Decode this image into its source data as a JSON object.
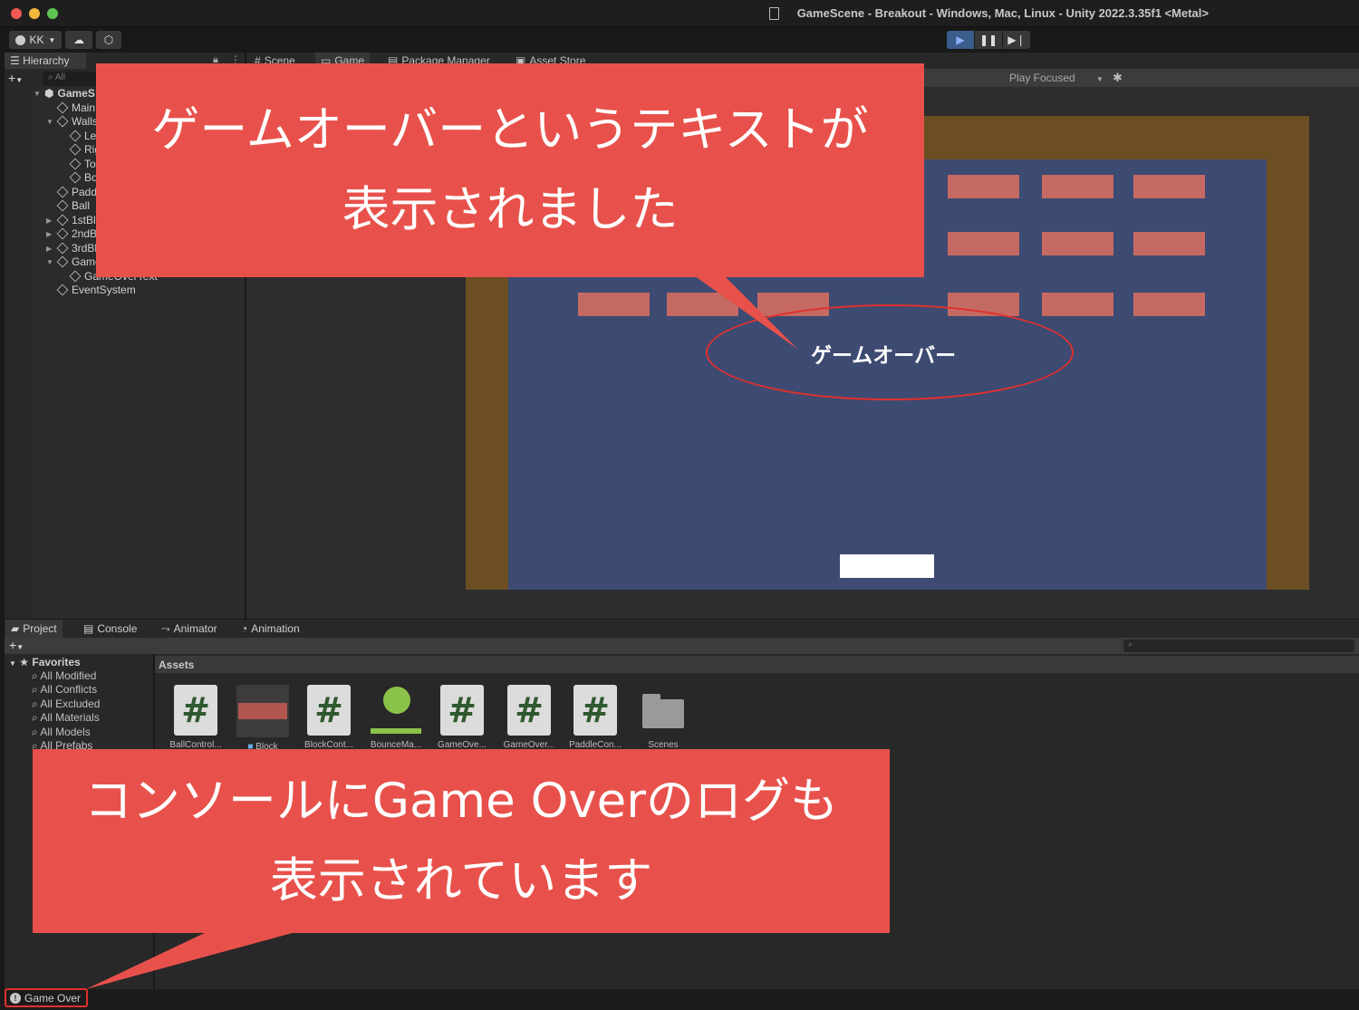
{
  "window": {
    "title": "GameScene - Breakout - Windows, Mac, Linux - Unity 2022.3.35f1 <Metal>"
  },
  "toolbar": {
    "account": "KK",
    "account_icon": "user-icon",
    "cloud_icon": "cloud-icon",
    "services_icon": "services-icon",
    "play_icon": "play-icon",
    "pause_icon": "pause-icon",
    "step_icon": "step-icon"
  },
  "hierarchy": {
    "tab_label": "Hierarchy",
    "search_placeholder": "All",
    "rows": [
      {
        "label": "GameS"
      },
      {
        "label": "Main"
      },
      {
        "label": "Walls"
      },
      {
        "label": "Lef"
      },
      {
        "label": "Rig"
      },
      {
        "label": "Top"
      },
      {
        "label": "Bot"
      },
      {
        "label": "Paddl"
      },
      {
        "label": "Ball"
      },
      {
        "label": "1stBlo"
      },
      {
        "label": "2ndBl"
      },
      {
        "label": "3rdBlo"
      },
      {
        "label": "GameC"
      },
      {
        "label": "GameOverText"
      },
      {
        "label": "EventSystem"
      }
    ]
  },
  "center_tabs": {
    "scene": "Scene",
    "game": "Game",
    "package_manager": "Package Manager",
    "asset_store": "Asset Store"
  },
  "game_toolbar": {
    "play_mode": "Play Focused"
  },
  "game": {
    "gameover_text": "ゲームオーバー",
    "colors": {
      "frame": "#6b4f22",
      "field": "#3d4a72",
      "block": "#c56a62",
      "paddle": "#ffffff"
    }
  },
  "bottom_tabs": {
    "project": "Project",
    "console": "Console",
    "animator": "Animator",
    "animation": "Animation"
  },
  "project": {
    "favorites_label": "Favorites",
    "favorites": [
      "All Modified",
      "All Conflicts",
      "All Excluded",
      "All Materials",
      "All Models",
      "All Prefabs"
    ],
    "assets_header": "Assets",
    "assets": [
      {
        "label": "BallControl...",
        "kind": "script"
      },
      {
        "label": "Block",
        "kind": "prefab"
      },
      {
        "label": "BlockCont...",
        "kind": "script"
      },
      {
        "label": "BounceMa...",
        "kind": "physics-material"
      },
      {
        "label": "GameOve...",
        "kind": "script"
      },
      {
        "label": "GameOver...",
        "kind": "script"
      },
      {
        "label": "PaddleCon...",
        "kind": "script"
      },
      {
        "label": "Scenes",
        "kind": "folder"
      }
    ]
  },
  "statusbar": {
    "message": "Game Over"
  },
  "annotations": {
    "top_line1": "ゲームオーバーというテキストが",
    "top_line2": "表示されました",
    "bottom_line1": "コンソールにGame Overのログも",
    "bottom_line2": "表示されています",
    "accent_color": "#e8514b"
  }
}
